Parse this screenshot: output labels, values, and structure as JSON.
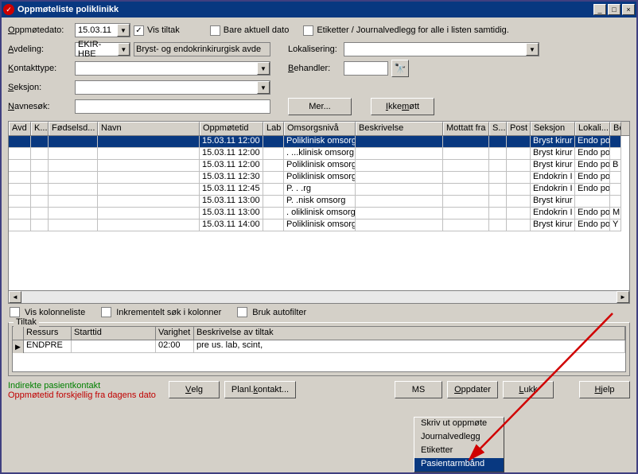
{
  "window": {
    "title": "Oppmøteliste poliklinikk"
  },
  "form": {
    "oppmotedato_label": "Oppmøtedato:",
    "oppmotedato_value": "15.03.11",
    "vis_tiltak_label": "Vis tiltak",
    "bare_aktuell_label": "Bare aktuell dato",
    "etiketter_label": "Etiketter / Journalvedlegg for alle i listen samtidig.",
    "avdeling_label": "Avdeling:",
    "avdeling_value": "EKIR-HBE",
    "avdeling_name": "Bryst- og endokrinkirurgisk avde",
    "lokalisering_label": "Lokalisering:",
    "kontakttype_label": "Kontakttype:",
    "behandler_label": "Behandler:",
    "seksjon_label": "Seksjon:",
    "navnesok_label": "Navnesøk:",
    "mer_btn": "Mer...",
    "ikke_mott_btn": "Ikke møtt"
  },
  "grid": {
    "headers": {
      "avd": "Avd",
      "k": "K...",
      "fodselsd": "Fødselsd...",
      "navn": "Navn",
      "oppmotetid": "Oppmøtetid",
      "lab": "Lab",
      "omsorgsniva": "Omsorgsnivå",
      "beskrivelse": "Beskrivelse",
      "mottatt": "Mottatt fra",
      "s": "S...",
      "post": "Post",
      "seksjon": "Seksjon",
      "lokali": "Lokali...",
      "be": "Be"
    },
    "rows": [
      {
        "tid": "15.03.11 12:00",
        "omsorg": "Poliklinisk omsorg",
        "seksjon": "Bryst kirur",
        "lokali": "Endo pol",
        "be": ""
      },
      {
        "tid": "15.03.11 12:00",
        "omsorg": ". ...klinisk omsorg",
        "seksjon": "Bryst kirur",
        "lokali": "Endo pol",
        "be": ""
      },
      {
        "tid": "15.03.11 12:00",
        "omsorg": "Poliklinisk omsorg",
        "seksjon": "Bryst kirur",
        "lokali": "Endo pol",
        "be": "B"
      },
      {
        "tid": "15.03.11 12:30",
        "omsorg": "Poliklinisk omsorg",
        "seksjon": "Endokrin I",
        "lokali": "Endo pol",
        "be": ""
      },
      {
        "tid": "15.03.11 12:45",
        "omsorg": "P.       .          .rg",
        "seksjon": "Endokrin I",
        "lokali": "Endo pol",
        "be": ""
      },
      {
        "tid": "15.03.11 13:00",
        "omsorg": "P.    .nisk omsorg",
        "seksjon": "Bryst kirur",
        "lokali": "",
        "be": ""
      },
      {
        "tid": "15.03.11 13:00",
        "omsorg": ". oliklinisk omsorg",
        "seksjon": "Endokrin I",
        "lokali": "Endo pol",
        "be": "M"
      },
      {
        "tid": "15.03.11 14:00",
        "omsorg": "Poliklinisk omsorg",
        "seksjon": "Bryst kirur",
        "lokali": "Endo pol",
        "be": "Y"
      }
    ]
  },
  "options": {
    "vis_kolonneliste": "Vis kolonneliste",
    "inkrementelt": "Inkrementelt søk i kolonner",
    "bruk_autofilter": "Bruk autofilter"
  },
  "tiltak": {
    "legend": "Tiltak",
    "headers": {
      "ressurs": "Ressurs",
      "starttid": "Starttid",
      "varighet": "Varighet",
      "beskrivelse": "Beskrivelse av tiltak"
    },
    "row": {
      "ressurs": "ENDPRE",
      "starttid": "",
      "varighet": "02:00",
      "beskrivelse": "pre us. lab, scint,"
    }
  },
  "footer": {
    "indirekte": "Indirekte pasientkontakt",
    "forskjellig": "Oppmøtetid forskjellig fra dagens dato"
  },
  "buttons": {
    "velg": "Velg",
    "planl": "Planl.kontakt...",
    "ms": "MS",
    "oppdater": "Oppdater",
    "lukk": "Lukk",
    "hjelp": "Hjelp"
  },
  "context_menu": {
    "items": [
      "Skriv ut oppmøte",
      "Journalvedlegg",
      "Etiketter",
      "Pasientarmbånd"
    ],
    "selected_index": 3
  }
}
